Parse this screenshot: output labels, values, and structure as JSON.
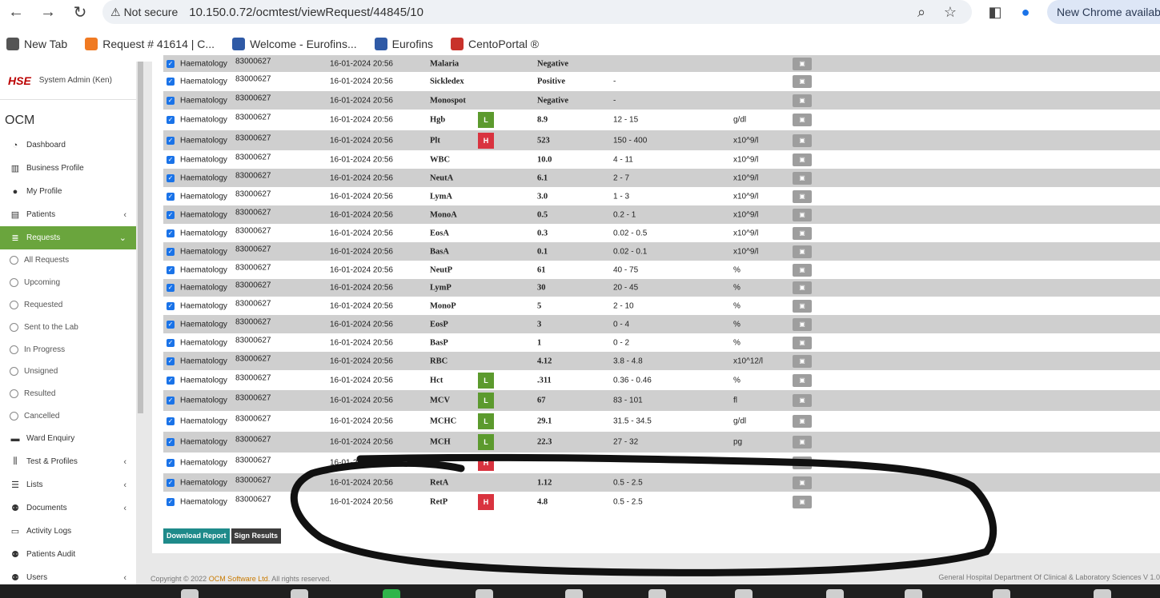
{
  "browser": {
    "security_label": "Not secure",
    "url": "10.150.0.72/ocmtest/viewRequest/44845/10",
    "update_label": "New Chrome available"
  },
  "bookmarks": [
    {
      "label": "New Tab",
      "icon": "globe-icon",
      "color": "#555555"
    },
    {
      "label": "Request # 41614 | C...",
      "icon": "request-icon",
      "color": "#f07a22"
    },
    {
      "label": "Welcome - Eurofins...",
      "icon": "eurofins-icon",
      "color": "#2f5aa6"
    },
    {
      "label": "Eurofins",
      "icon": "eurofins-icon",
      "color": "#2f5aa6"
    },
    {
      "label": "CentoPortal ®",
      "icon": "cento-icon",
      "color": "#c8322b"
    }
  ],
  "sidebar": {
    "user": "System Admin (Ken)",
    "brand": "OCM",
    "items": [
      {
        "label": "Dashboard",
        "icon": "dashboard-icon",
        "glyph": "◔",
        "caret": ""
      },
      {
        "label": "Business Profile",
        "icon": "building-icon",
        "glyph": "▥",
        "caret": ""
      },
      {
        "label": "My Profile",
        "icon": "user-icon",
        "glyph": "●",
        "caret": ""
      },
      {
        "label": "Patients",
        "icon": "id-card-icon",
        "glyph": "▤",
        "caret": "‹"
      },
      {
        "label": "Requests",
        "icon": "database-icon",
        "glyph": "≣",
        "caret": "⌄",
        "active": true
      },
      {
        "label": "All Requests",
        "sub": true
      },
      {
        "label": "Upcoming",
        "sub": true
      },
      {
        "label": "Requested",
        "sub": true
      },
      {
        "label": "Sent to the Lab",
        "sub": true
      },
      {
        "label": "In Progress",
        "sub": true
      },
      {
        "label": "Unsigned",
        "sub": true
      },
      {
        "label": "Resulted",
        "sub": true
      },
      {
        "label": "Cancelled",
        "sub": true
      },
      {
        "label": "Ward Enquiry",
        "icon": "bed-icon",
        "glyph": "▬",
        "caret": ""
      },
      {
        "label": "Test & Profiles",
        "icon": "vials-icon",
        "glyph": "⫼",
        "caret": "‹"
      },
      {
        "label": "Lists",
        "icon": "list-icon",
        "glyph": "☰",
        "caret": "‹"
      },
      {
        "label": "Documents",
        "icon": "users-icon",
        "glyph": "⚉",
        "caret": "‹"
      },
      {
        "label": "Activity Logs",
        "icon": "log-icon",
        "glyph": "▭",
        "caret": ""
      },
      {
        "label": "Patients Audit",
        "icon": "users-icon",
        "glyph": "⚉",
        "caret": ""
      },
      {
        "label": "Users",
        "icon": "users-icon",
        "glyph": "⚉",
        "caret": "‹"
      }
    ]
  },
  "results": [
    {
      "dept": "Haematology",
      "num": "83000627",
      "date": "16-01-2024 20:56",
      "test": "Malaria",
      "flag": "",
      "result": "Negative",
      "range": "",
      "unit": ""
    },
    {
      "dept": "Haematology",
      "num": "83000627",
      "date": "16-01-2024 20:56",
      "test": "Sickledex",
      "flag": "",
      "result": "Positive",
      "range": "-",
      "unit": ""
    },
    {
      "dept": "Haematology",
      "num": "83000627",
      "date": "16-01-2024 20:56",
      "test": "Monospot",
      "flag": "",
      "result": "Negative",
      "range": "-",
      "unit": ""
    },
    {
      "dept": "Haematology",
      "num": "83000627",
      "date": "16-01-2024 20:56",
      "test": "Hgb",
      "flag": "L",
      "result": "8.9",
      "range": "12 - 15",
      "unit": "g/dl"
    },
    {
      "dept": "Haematology",
      "num": "83000627",
      "date": "16-01-2024 20:56",
      "test": "Plt",
      "flag": "H",
      "result": "523",
      "range": "150 - 400",
      "unit": "x10^9/l"
    },
    {
      "dept": "Haematology",
      "num": "83000627",
      "date": "16-01-2024 20:56",
      "test": "WBC",
      "flag": "",
      "result": "10.0",
      "range": "4 - 11",
      "unit": "x10^9/l"
    },
    {
      "dept": "Haematology",
      "num": "83000627",
      "date": "16-01-2024 20:56",
      "test": "NeutA",
      "flag": "",
      "result": "6.1",
      "range": "2 - 7",
      "unit": "x10^9/l"
    },
    {
      "dept": "Haematology",
      "num": "83000627",
      "date": "16-01-2024 20:56",
      "test": "LymA",
      "flag": "",
      "result": "3.0",
      "range": "1 - 3",
      "unit": "x10^9/l"
    },
    {
      "dept": "Haematology",
      "num": "83000627",
      "date": "16-01-2024 20:56",
      "test": "MonoA",
      "flag": "",
      "result": "0.5",
      "range": "0.2 - 1",
      "unit": "x10^9/l"
    },
    {
      "dept": "Haematology",
      "num": "83000627",
      "date": "16-01-2024 20:56",
      "test": "EosA",
      "flag": "",
      "result": "0.3",
      "range": "0.02 - 0.5",
      "unit": "x10^9/l"
    },
    {
      "dept": "Haematology",
      "num": "83000627",
      "date": "16-01-2024 20:56",
      "test": "BasA",
      "flag": "",
      "result": "0.1",
      "range": "0.02 - 0.1",
      "unit": "x10^9/l"
    },
    {
      "dept": "Haematology",
      "num": "83000627",
      "date": "16-01-2024 20:56",
      "test": "NeutP",
      "flag": "",
      "result": "61",
      "range": "40 - 75",
      "unit": "%"
    },
    {
      "dept": "Haematology",
      "num": "83000627",
      "date": "16-01-2024 20:56",
      "test": "LymP",
      "flag": "",
      "result": "30",
      "range": "20 - 45",
      "unit": "%"
    },
    {
      "dept": "Haematology",
      "num": "83000627",
      "date": "16-01-2024 20:56",
      "test": "MonoP",
      "flag": "",
      "result": "5",
      "range": "2 - 10",
      "unit": "%"
    },
    {
      "dept": "Haematology",
      "num": "83000627",
      "date": "16-01-2024 20:56",
      "test": "EosP",
      "flag": "",
      "result": "3",
      "range": "0 - 4",
      "unit": "%"
    },
    {
      "dept": "Haematology",
      "num": "83000627",
      "date": "16-01-2024 20:56",
      "test": "BasP",
      "flag": "",
      "result": "1",
      "range": "0 - 2",
      "unit": "%"
    },
    {
      "dept": "Haematology",
      "num": "83000627",
      "date": "16-01-2024 20:56",
      "test": "RBC",
      "flag": "",
      "result": "4.12",
      "range": "3.8 - 4.8",
      "unit": "x10^12/l"
    },
    {
      "dept": "Haematology",
      "num": "83000627",
      "date": "16-01-2024 20:56",
      "test": "Hct",
      "flag": "L",
      "result": ".311",
      "range": "0.36 - 0.46",
      "unit": "%"
    },
    {
      "dept": "Haematology",
      "num": "83000627",
      "date": "16-01-2024 20:56",
      "test": "MCV",
      "flag": "L",
      "result": "67",
      "range": "83 - 101",
      "unit": "fl"
    },
    {
      "dept": "Haematology",
      "num": "83000627",
      "date": "16-01-2024 20:56",
      "test": "MCHC",
      "flag": "L",
      "result": "29.1",
      "range": "31.5 - 34.5",
      "unit": "g/dl"
    },
    {
      "dept": "Haematology",
      "num": "83000627",
      "date": "16-01-2024 20:56",
      "test": "MCH",
      "flag": "L",
      "result": "22.3",
      "range": "27 - 32",
      "unit": "pg"
    },
    {
      "dept": "Haematology",
      "num": "83000627",
      "date": "16-01-2024 20:56",
      "test": "",
      "flag": "H",
      "result": "",
      "range": "",
      "unit": ""
    },
    {
      "dept": "Haematology",
      "num": "83000627",
      "date": "16-01-2024 20:56",
      "test": "RetA",
      "flag": "",
      "result": "1.12",
      "range": "0.5 - 2.5",
      "unit": ""
    },
    {
      "dept": "Haematology",
      "num": "83000627",
      "date": "16-01-2024 20:56",
      "test": "RetP",
      "flag": "H",
      "result": "4.8",
      "range": "0.5 - 2.5",
      "unit": ""
    }
  ],
  "actions": {
    "download": "Download Report",
    "sign": "Sign Results"
  },
  "footer": {
    "prefix": "Copyright © 2022 ",
    "company": "OCM Software Ltd.",
    "suffix": " All rights reserved.",
    "right": "General Hospital Department Of Clinical & Laboratory Sciences V 1.0"
  },
  "colors": {
    "accent": "#6aa53d",
    "flag_low": "#5c9a2e",
    "flag_high": "#d9333f",
    "download_btn": "#1e8a8a"
  }
}
